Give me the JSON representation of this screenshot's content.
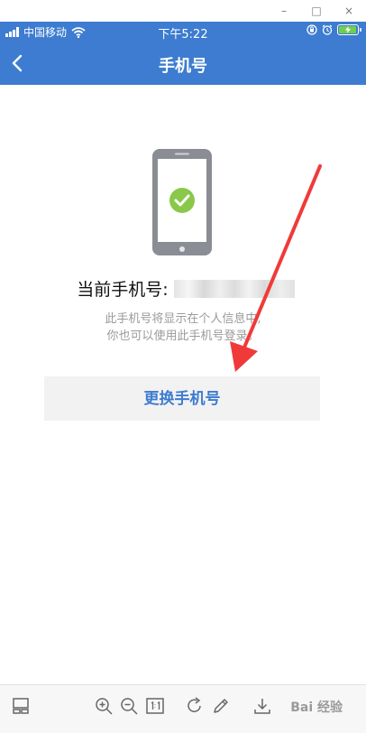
{
  "window": {
    "minimize": "–",
    "maximize": "□",
    "close": "×"
  },
  "status_bar": {
    "carrier": "中国移动",
    "time": "下午5:22",
    "battery_level": 1.0
  },
  "nav": {
    "title": "手机号"
  },
  "main": {
    "current_label": "当前手机号:",
    "hint_line1": "此手机号将显示在个人信息中,",
    "hint_line2": "你也可以使用此手机号登录。",
    "change_button": "更换手机号"
  },
  "watermark": {
    "text": "Bai 经验"
  },
  "colors": {
    "brand": "#3d7cd0",
    "check": "#8ac84a",
    "annotation": "#f03a3a"
  }
}
